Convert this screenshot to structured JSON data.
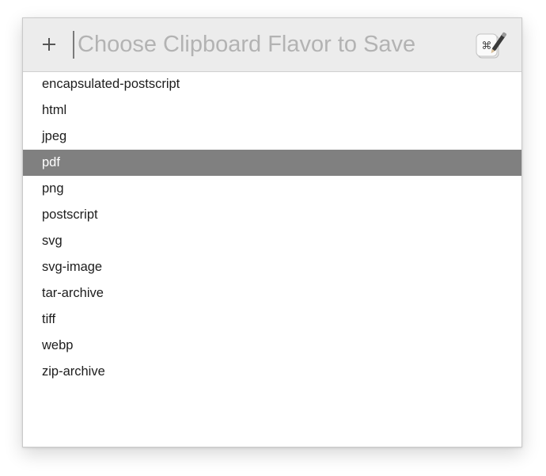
{
  "header": {
    "add_button_label": "+",
    "search_placeholder": "Choose Clipboard Flavor to Save",
    "search_value": "",
    "app_icon": "clipboard-command-icon"
  },
  "list": {
    "selected_index": 3,
    "items": [
      "encapsulated-postscript",
      "html",
      "jpeg",
      "pdf",
      "png",
      "postscript",
      "svg",
      "svg-image",
      "tar-archive",
      "tiff",
      "webp",
      "zip-archive"
    ]
  },
  "colors": {
    "header_bg": "#ececec",
    "selection_bg": "#808080",
    "placeholder": "#b3b3b3"
  }
}
